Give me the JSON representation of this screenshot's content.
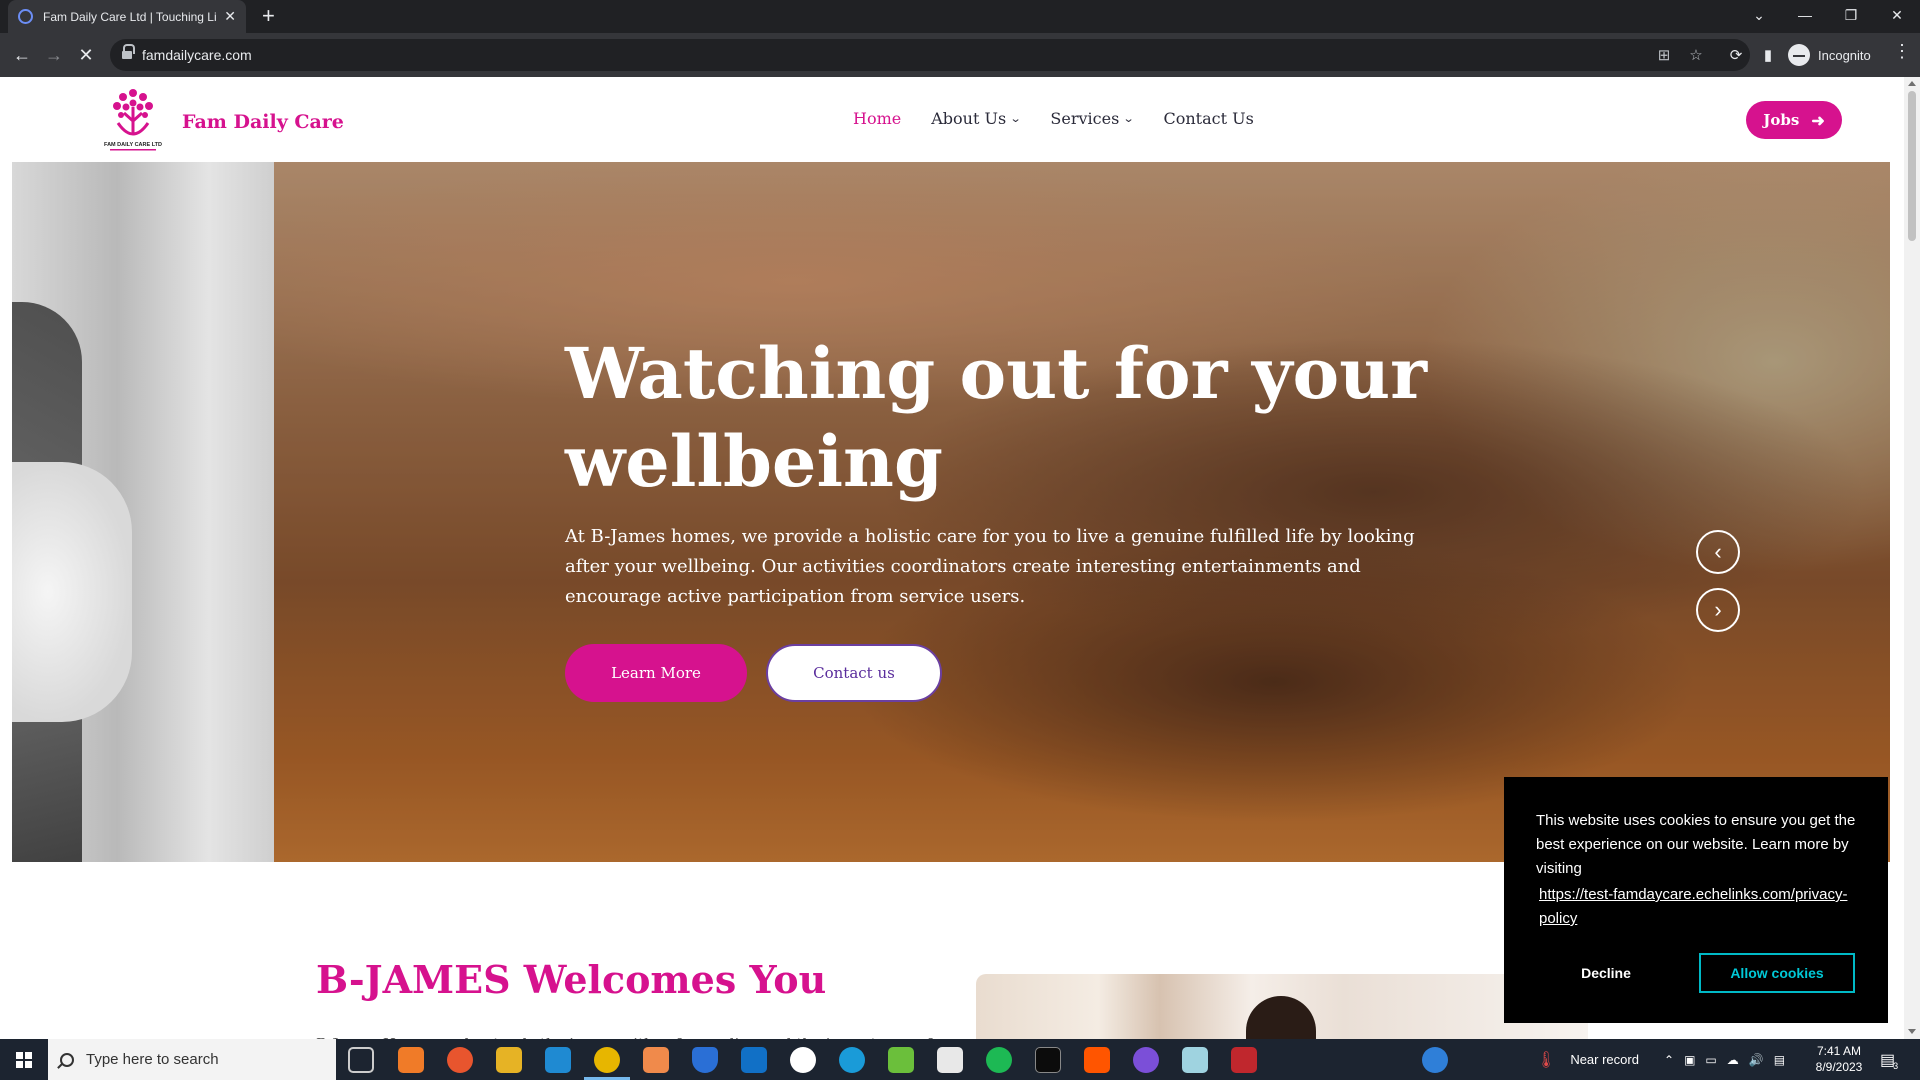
{
  "browser": {
    "tab_title": "Fam Daily Care Ltd | Touching Liv",
    "new_tab": "+",
    "url": "famdailycare.com",
    "profile_label": "Incognito"
  },
  "site": {
    "brand": "Fam Daily Care",
    "logo_text": "FAM DAILY CARE LTD",
    "nav": [
      {
        "label": "Home",
        "active": true
      },
      {
        "label": "About Us",
        "has_dropdown": true
      },
      {
        "label": "Services",
        "has_dropdown": true
      },
      {
        "label": "Contact Us"
      }
    ],
    "jobs_button": "Jobs",
    "accent_color": "#d6128e"
  },
  "hero": {
    "title_line1": "Watching out for your",
    "title_line2": "wellbeing",
    "text": "At B-James homes, we provide a holistic care for you to live a genuine fulfilled life by looking after your wellbeing. Our activities coordinators create interesting entertainments and encourage active participation from service users.",
    "learn_more": "Learn More",
    "contact_us": "Contact us",
    "prev_icon": "chevron-left-icon",
    "next_icon": "chevron-right-icon"
  },
  "welcome": {
    "title": "B-JAMES Welcomes You",
    "text": "B-James Homes understands the issues with safeguarding and the importance of"
  },
  "cookie": {
    "message": "This website uses cookies to ensure you get the best experience on our website. Learn more by visiting",
    "link": "https://test-famdaycare.echelinks.com/privacy-policy",
    "decline": "Decline",
    "allow": "Allow cookies"
  },
  "taskbar": {
    "search_placeholder": "Type here to search",
    "weather": "Near record",
    "time": "7:41 AM",
    "date": "8/9/2023",
    "notification_count": "3"
  }
}
